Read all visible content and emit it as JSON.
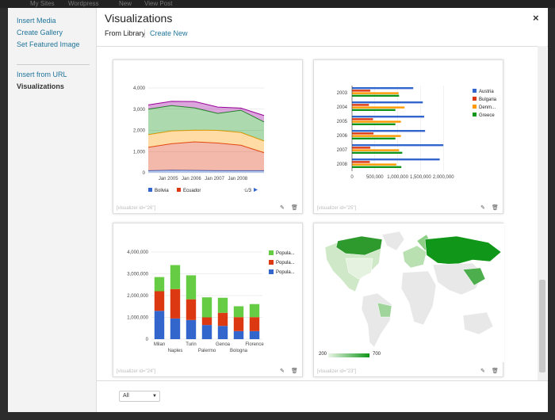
{
  "adminbar": {
    "items": [
      "My Sites",
      "Wordpress",
      "New",
      "View Post"
    ]
  },
  "menu": {
    "items": [
      {
        "label": "Insert Media"
      },
      {
        "label": "Create Gallery"
      },
      {
        "label": "Set Featured Image"
      },
      {
        "label": "Insert from URL"
      },
      {
        "label": "Visualizations"
      }
    ]
  },
  "modal": {
    "title": "Visualizations",
    "close_label": "×"
  },
  "tabs": {
    "from_library": "From Library",
    "create_new": "Create New"
  },
  "cards": [
    {
      "shortcode": "[visualizer id=\"26\"]",
      "pager": "1/3"
    },
    {
      "shortcode": "[visualizer id=\"25\"]"
    },
    {
      "shortcode": "[visualizer id=\"24\"]"
    },
    {
      "shortcode": "[visualizer id=\"23\"]"
    }
  ],
  "icons": {
    "edit": "edit-icon",
    "delete": "trash-icon"
  },
  "footer": {
    "filter_value": "All"
  },
  "colors": {
    "blue": "#3366cc",
    "red": "#dc3912",
    "orange": "#ff9900",
    "green": "#109618",
    "purple": "#990099",
    "light_green": "#66cc44"
  },
  "chart_data": [
    {
      "type": "area",
      "x": [
        "2004",
        "2005",
        "2006",
        "2007",
        "2008",
        "2009"
      ],
      "xticks": [
        "Jan 2005",
        "Jan 2006",
        "Jan 2007",
        "Jan 2008"
      ],
      "yticks": [
        "0",
        "1,000",
        "2,000",
        "3,000",
        "4,000"
      ],
      "ylim": [
        0,
        4000
      ],
      "stacked": true,
      "series": [
        {
          "name": "Bolivia",
          "values": [
            100,
            120,
            110,
            100,
            100,
            100
          ]
        },
        {
          "name": "Ecuador",
          "values": [
            1100,
            1250,
            1350,
            1300,
            1200,
            850
          ]
        },
        {
          "name": "",
          "values": [
            600,
            600,
            550,
            600,
            600,
            550
          ]
        },
        {
          "name": "",
          "values": [
            1200,
            1200,
            1050,
            800,
            1050,
            900
          ]
        },
        {
          "name": "",
          "values": [
            200,
            200,
            300,
            300,
            100,
            300
          ]
        }
      ],
      "legend_position": "bottom",
      "visible_legend": [
        "Bolivia",
        "Ecuador"
      ]
    },
    {
      "type": "bar",
      "orientation": "horizontal",
      "categories": [
        "2003",
        "2004",
        "2005",
        "2006",
        "2007",
        "2008"
      ],
      "xticks": [
        "0",
        "500,000",
        "1,000,000",
        "1,500,000",
        "2,000,000"
      ],
      "xlim": [
        0,
        2500000
      ],
      "series": [
        {
          "name": "Austria",
          "values": [
            1340000,
            1550000,
            1580000,
            1600000,
            2000000,
            1920000
          ]
        },
        {
          "name": "Bulgaria",
          "values": [
            400000,
            370000,
            460000,
            470000,
            400000,
            390000
          ]
        },
        {
          "name": "Denm...",
          "values": [
            1020000,
            1150000,
            1070000,
            1070000,
            1030000,
            970000
          ]
        },
        {
          "name": "Greece",
          "values": [
            1030000,
            950000,
            950000,
            950000,
            1100000,
            1080000
          ]
        }
      ],
      "legend_position": "right"
    },
    {
      "type": "bar",
      "stacked": true,
      "categories": [
        "Milan",
        "Naples",
        "Turin",
        "Palermo",
        "Genoa",
        "Bologna",
        "Florence"
      ],
      "yticks": [
        "0",
        "1,000,000",
        "2,000,000",
        "3,000,000",
        "4,000,000"
      ],
      "ylim": [
        0,
        4000000
      ],
      "series": [
        {
          "name": "Popula...",
          "values": [
            1300000,
            950000,
            880000,
            650000,
            610000,
            370000,
            370000
          ]
        },
        {
          "name": "Popula...",
          "values": [
            900000,
            1350000,
            950000,
            350000,
            600000,
            640000,
            640000
          ]
        },
        {
          "name": "Popula...",
          "values": [
            650000,
            1100000,
            1100000,
            920000,
            690000,
            500000,
            600000
          ]
        }
      ],
      "legend_position": "right"
    },
    {
      "type": "geo",
      "colorbar": {
        "min": "200",
        "max": "700"
      }
    }
  ]
}
